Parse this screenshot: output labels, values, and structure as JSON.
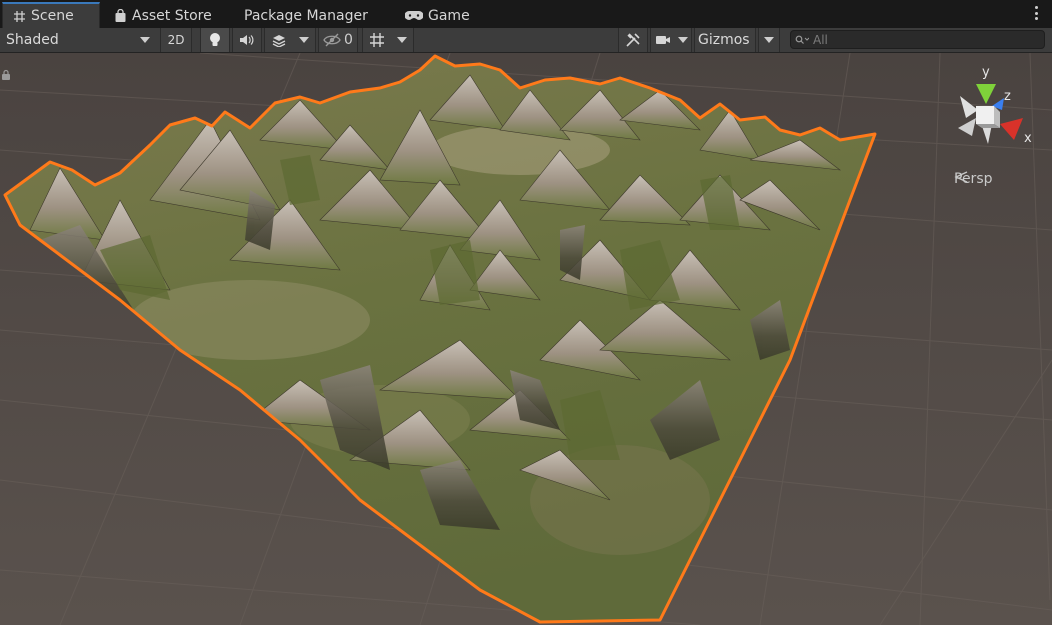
{
  "tabs": [
    {
      "label": "Scene",
      "icon": "grid-icon",
      "active": true
    },
    {
      "label": "Asset Store",
      "icon": "shopping-bag-icon",
      "active": false
    },
    {
      "label": "Package Manager",
      "icon": "",
      "active": false
    },
    {
      "label": "Game",
      "icon": "gamepad-icon",
      "active": false
    }
  ],
  "toolbar": {
    "shading_mode": "Shaded",
    "mode_2d": "2D",
    "hidden_count": "0",
    "gizmos_label": "Gizmos",
    "search_placeholder": "All"
  },
  "viewport": {
    "projection_label": "Persp",
    "axes": {
      "x": "x",
      "y": "y",
      "z": "z"
    },
    "selection_outline_color": "#ff7a1a",
    "background_color": "#4c4542"
  }
}
